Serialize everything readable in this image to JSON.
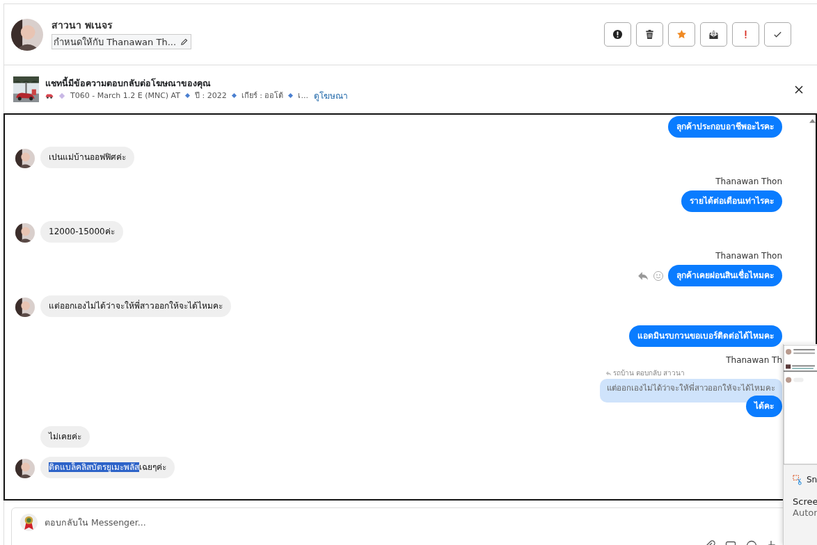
{
  "header": {
    "name": "สาวนา พเนจร",
    "assignee": "กำหนดให้กับ Thanawan Th...",
    "actions": [
      {
        "kind": "alert"
      },
      {
        "kind": "delete"
      },
      {
        "kind": "star"
      },
      {
        "kind": "mail"
      },
      {
        "kind": "urgent"
      },
      {
        "kind": "done"
      }
    ]
  },
  "ad": {
    "title": "แชทนี้มีข้อความตอบกลับต่อโฆษณาของคุณ",
    "details": [
      "T060 - March 1.2 E (MNC) AT",
      "ปี : 2022",
      "เกียร์ : ออโต้",
      "เ..."
    ],
    "link": "ดูโฆษณา"
  },
  "messages": [
    {
      "kind": "outgoing",
      "text": "ลุกค้าประกอบอาชีพอะไรคะ",
      "hover_actions": false
    },
    {
      "kind": "incoming",
      "text": "เปนแม่บ้านออฟฟิศค่ะ",
      "avatar": true
    },
    {
      "kind": "outgoing",
      "sender": "Thanawan Thon",
      "text": "รายได้ต่อเดือนเท่าไรคะ",
      "hover_actions": false
    },
    {
      "kind": "incoming",
      "text": "12000-15000ค่ะ",
      "avatar": true
    },
    {
      "kind": "outgoing",
      "sender": "Thanawan Thon",
      "text": "ลุกค้าเคยผ่อนสินเชื่อไหมคะ",
      "hover_actions": true
    },
    {
      "kind": "incoming",
      "text": "แต่ออกเองไม่ได้ว่าจะให้พี่สาวออกให้จะได้ไหมคะ",
      "avatar": true
    },
    {
      "kind": "outgoing",
      "text": "แอดมินรบกวนขอเบอร์ติดต่อได้ไหมคะ",
      "hover_actions": false
    },
    {
      "kind": "outgoing",
      "sender": "Thanawan Th",
      "reply_label": "รถบ้าน ตอบกลับ สาวนา",
      "quoted": "แต่ออกเองไม่ได้ว่าจะให้พี่สาวออกให้จะได้ไหมคะ",
      "text": "ได้คะ",
      "hover_actions": false
    },
    {
      "kind": "incoming",
      "text": "ไม่เคยค่ะ",
      "avatar": false
    },
    {
      "kind": "incoming",
      "segments": [
        {
          "text": "ติดแบล็คลิสบัตรยูเมะพลัส",
          "selected": true
        },
        {
          "text": "เฉยๆค่ะ",
          "selected": false
        }
      ],
      "avatar": true
    }
  ],
  "composer": {
    "placeholder": "ตอบกลับใน Messenger..."
  },
  "snip_notification": {
    "app": "Sn",
    "title": "Scree",
    "subtitle": "Autor"
  }
}
